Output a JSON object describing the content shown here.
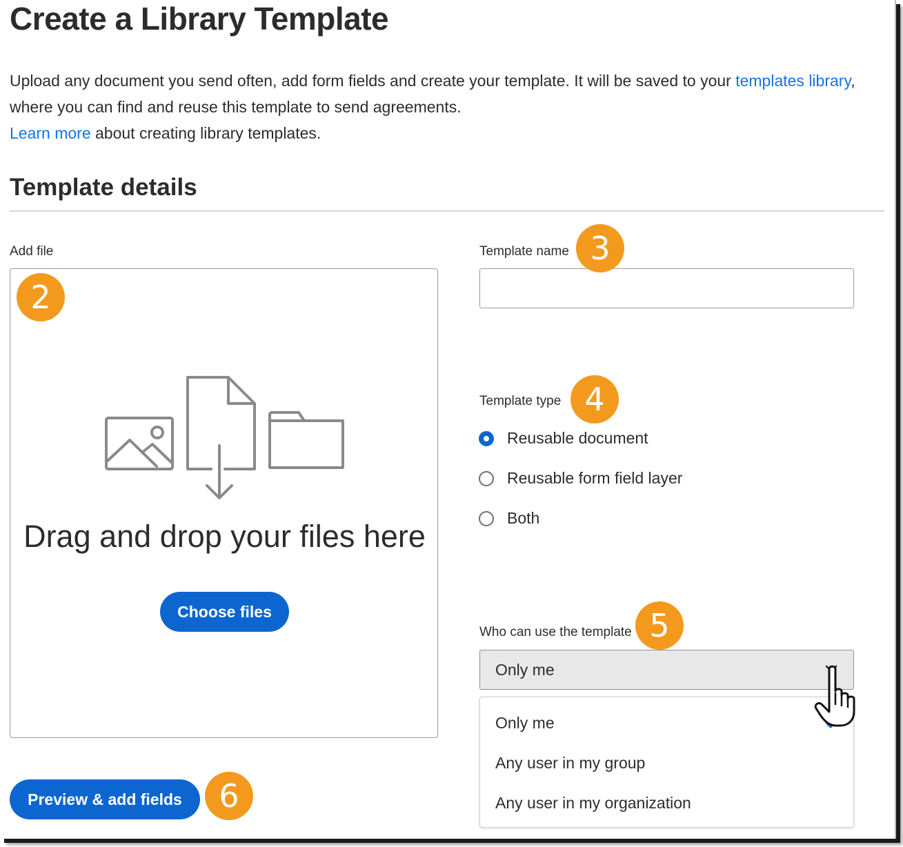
{
  "page": {
    "title": "Create a Library Template",
    "intro": {
      "line1_text": "Upload any document you send often, add form fields and create your template. It will be saved to your ",
      "library_link": "templates library",
      "line1_end": ",",
      "line2_text": "where you can find and reuse this template to send agreements.",
      "learn_more_link": "Learn more",
      "line3_text": " about creating library templates."
    },
    "section_title": "Template details"
  },
  "add_file": {
    "label": "Add file",
    "drop_text": "Drag and drop your files here",
    "choose_button": "Choose files"
  },
  "template_name": {
    "label": "Template name",
    "value": "",
    "placeholder": ""
  },
  "template_type": {
    "label": "Template type",
    "options": [
      {
        "label": "Reusable document",
        "checked": true
      },
      {
        "label": "Reusable form field layer",
        "checked": false
      },
      {
        "label": "Both",
        "checked": false
      }
    ]
  },
  "who_can_use": {
    "label": "Who can use the template",
    "selected": "Only me",
    "menu_items": [
      "Only me",
      "Any user in my group",
      "Any user in my organization"
    ]
  },
  "footer": {
    "preview_button": "Preview & add fields"
  },
  "callouts": [
    "2",
    "3",
    "4",
    "5",
    "6"
  ],
  "colors": {
    "accent": "#0d66d0",
    "link": "#1473e6",
    "callout": "#f39a1e"
  },
  "icons": [
    "image-icon",
    "file-upload-icon",
    "folder-icon",
    "chevron-down-icon",
    "checkmark-icon",
    "hand-pointer-cursor-icon"
  ]
}
